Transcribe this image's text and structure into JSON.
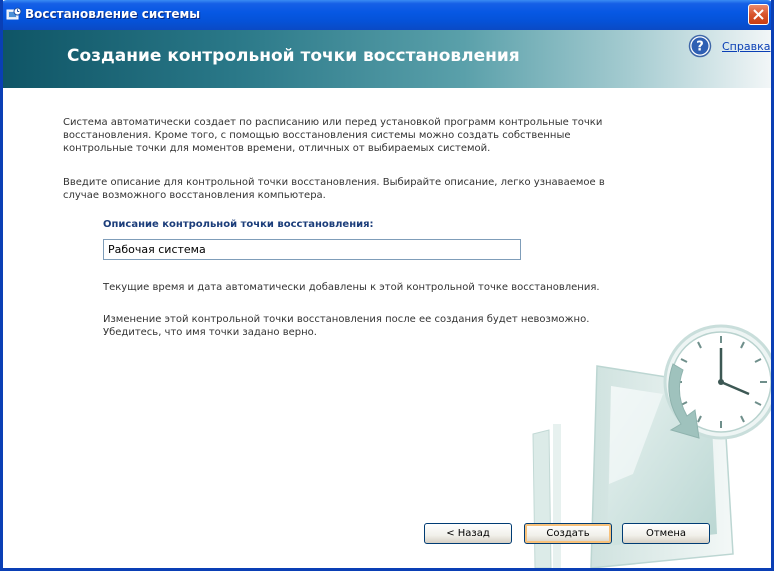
{
  "window": {
    "title": "Восстановление системы"
  },
  "header": {
    "title": "Создание контрольной точки восстановления",
    "help_label": "Справка"
  },
  "main": {
    "intro_lines": [
      "Система автоматически создает по расписанию или перед установкой программ контрольные точки",
      "восстановления. Кроме того, с помощью восстановления системы можно создать собственные",
      "контрольные точки для моментов времени, отличных от выбираемых системой."
    ],
    "instruction_lines": [
      "Введите описание для контрольной точки восстановления. Выбирайте описание, легко узнаваемое в",
      "случае возможного восстановления компьютера."
    ],
    "field_label": "Описание контрольной точки восстановления:",
    "field_value": "Рабочая система",
    "note_datetime": "Текущие время и дата автоматически добавлены к этой контрольной точке восстановления.",
    "warning_lines": [
      "Изменение этой контрольной точки восстановления после ее создания будет невозможно.",
      "Убедитесь, что имя точки задано верно."
    ]
  },
  "buttons": {
    "back_label": "< Назад",
    "create_label": "Создать",
    "cancel_label": "Отмена"
  },
  "colors": {
    "titlebar": "#0758e4",
    "banner_dark": "#0f5566",
    "label_blue": "#1b3d7a",
    "default_button_glow": "#f8c17a"
  },
  "icons": {
    "title": "system-restore-icon",
    "help": "question-mark-icon",
    "close": "close-x-icon",
    "art": "clock-monitor-illustration"
  }
}
